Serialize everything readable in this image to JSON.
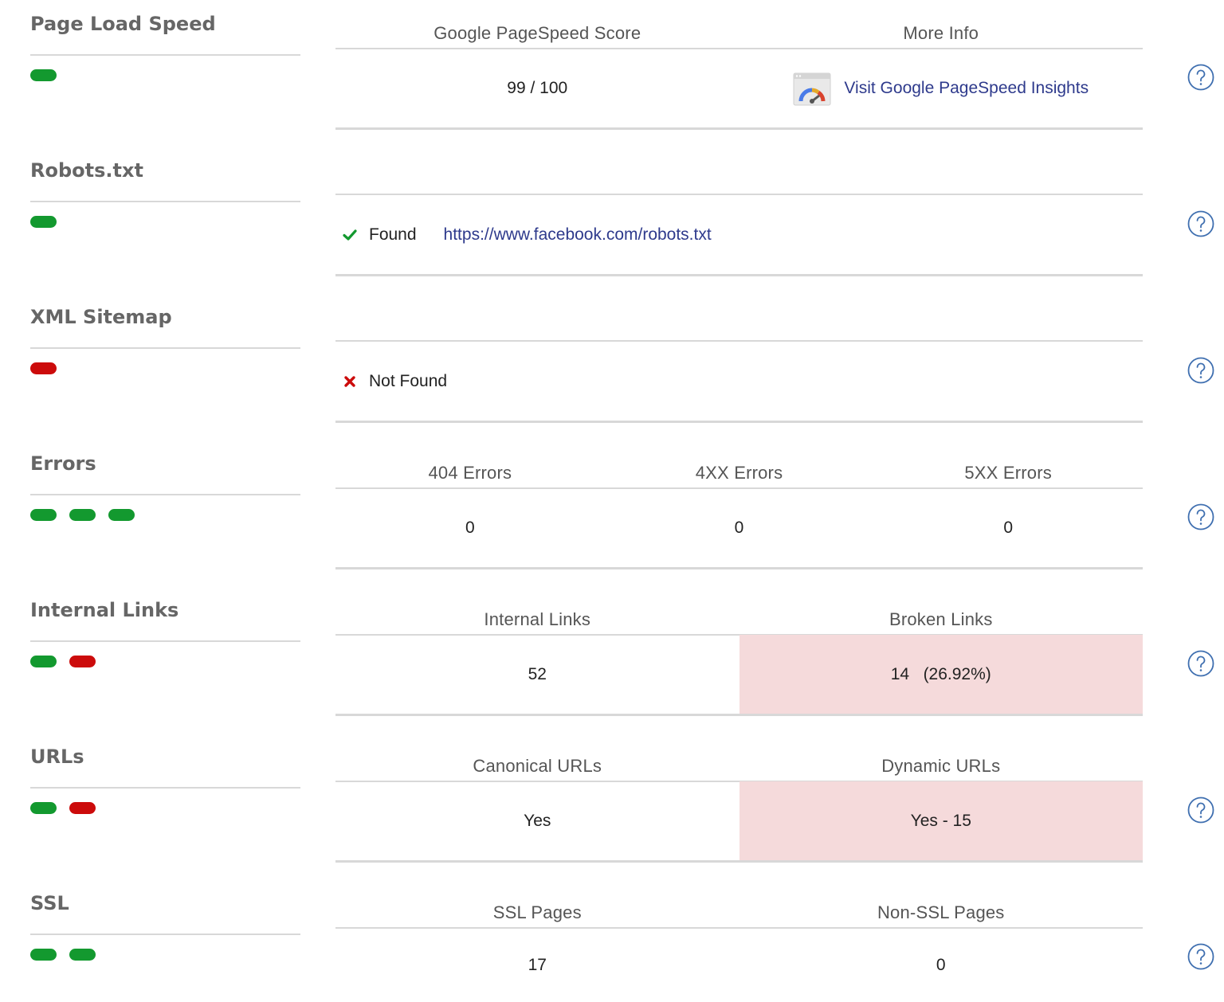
{
  "sections": {
    "page_load_speed": {
      "title": "Page Load Speed",
      "indicators": [
        "good"
      ],
      "headers": [
        "Google PageSpeed Score",
        "More Info"
      ],
      "score": "99 / 100",
      "link_text": "Visit Google PageSpeed Insights"
    },
    "robots": {
      "title": "Robots.txt",
      "indicators": [
        "good"
      ],
      "status": "Found",
      "url": "https://www.facebook.com/robots.txt"
    },
    "sitemap": {
      "title": "XML Sitemap",
      "indicators": [
        "bad"
      ],
      "status": "Not Found"
    },
    "errors": {
      "title": "Errors",
      "indicators": [
        "good",
        "good",
        "good"
      ],
      "headers": [
        "404 Errors",
        "4XX Errors",
        "5XX Errors"
      ],
      "values": [
        "0",
        "0",
        "0"
      ]
    },
    "internal_links": {
      "title": "Internal Links",
      "indicators": [
        "good",
        "bad"
      ],
      "headers": [
        "Internal Links",
        "Broken Links"
      ],
      "values": [
        "52",
        "14   (26.92%)"
      ]
    },
    "urls": {
      "title": "URLs",
      "indicators": [
        "good",
        "bad"
      ],
      "headers": [
        "Canonical URLs",
        "Dynamic URLs"
      ],
      "values": [
        "Yes",
        "Yes - 15"
      ]
    },
    "ssl": {
      "title": "SSL",
      "indicators": [
        "good",
        "good"
      ],
      "headers": [
        "SSL Pages",
        "Non-SSL Pages"
      ],
      "values": [
        "17",
        "0"
      ]
    }
  },
  "colors": {
    "good": "#13992f",
    "bad": "#cc0b0b",
    "alert_bg": "#f5dadb",
    "link": "#2e3a8c",
    "help_icon": "#3f6fb0"
  }
}
